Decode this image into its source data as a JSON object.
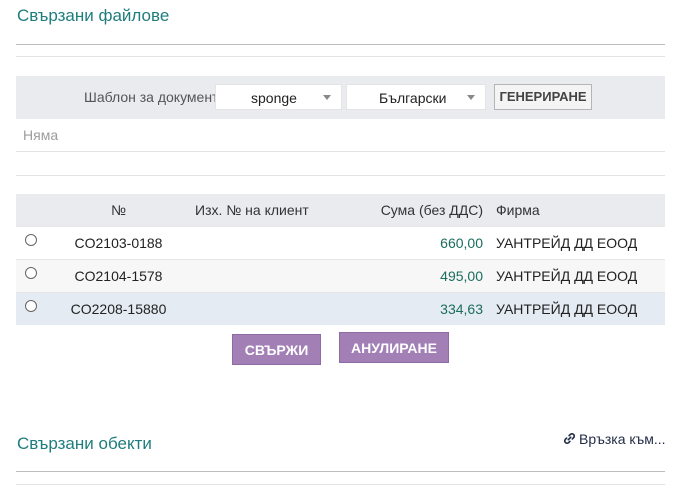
{
  "files_section": {
    "title": "Свързани файлове"
  },
  "generate": {
    "template_label": "Шаблон за документ",
    "template_select": "sponge",
    "language_select": "Български",
    "generate_button": "ГЕНЕРИРАНЕ",
    "empty_text": "Няма"
  },
  "table": {
    "headers": [
      "",
      "№",
      "Изх. № на клиент",
      "Сума (без ДДС)",
      "Фирма"
    ],
    "rows": [
      {
        "number": "CO2103-0188",
        "client_ref": "",
        "amount": "660,00",
        "company": "УАНТРЕЙД ДД ЕООД"
      },
      {
        "number": "CO2104-1578",
        "client_ref": "",
        "amount": "495,00",
        "company": "УАНТРЕЙД ДД ЕООД"
      },
      {
        "number": "CO2208-15880",
        "client_ref": "",
        "amount": "334,63",
        "company": "УАНТРЕЙД ДД ЕООД"
      }
    ]
  },
  "actions": {
    "link_button": "СВЪРЖИ",
    "cancel_button": "АНУЛИРАНЕ"
  },
  "objects_section": {
    "title": "Свързани обекти",
    "link_text": "Връзка към..."
  },
  "colors": {
    "heading": "#1f7d7d",
    "amount": "#1c6d5c",
    "button": "#a27fb5",
    "selected_row": "#e4ebf2"
  }
}
